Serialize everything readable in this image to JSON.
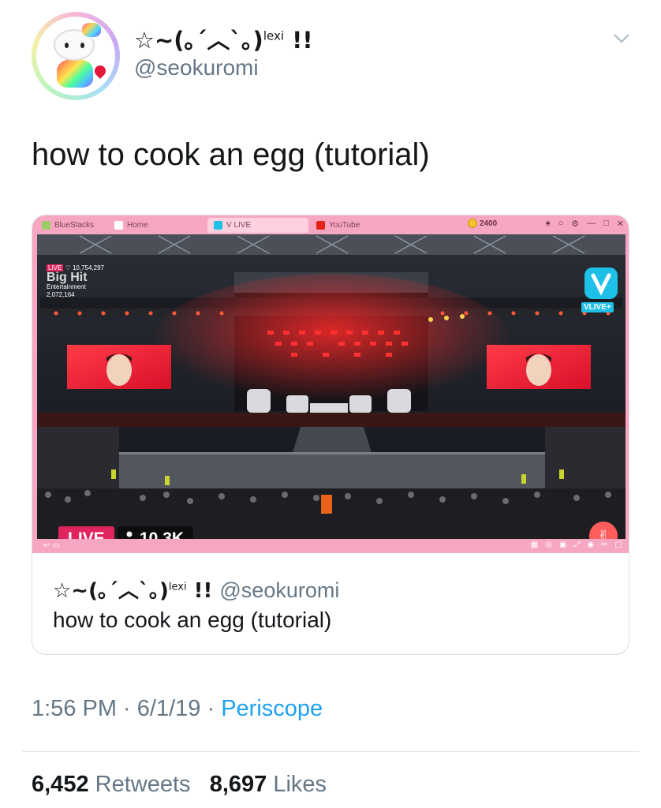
{
  "header": {
    "display_name": "☆~(｡´︿`｡)",
    "display_name_sup": "lexi",
    "display_name_suffix": " !!",
    "handle": "@seokuromi",
    "avatar_icon": "hello-kitty-avatar",
    "menu_icon": "chevron-down-icon"
  },
  "tweet": {
    "text": "how to cook an egg (tutorial)"
  },
  "embed": {
    "app_tabs": [
      "BlueStacks",
      "Home",
      "V LIVE",
      "YouTube"
    ],
    "coins": "2400",
    "window_controls": [
      "♠",
      "○",
      "⚙",
      "—",
      "□",
      "✕"
    ],
    "overlay": {
      "live_small": "LIVE",
      "hearts": "10,754,297",
      "brand": "Big Hit",
      "brand_sub": "Entertainment",
      "plays": "2,072,164"
    },
    "vlive_label": "VLIVE+",
    "live_badge": "LIVE",
    "viewers": "10.3K",
    "quote": {
      "display_name": "☆~(｡´︿`｡)",
      "display_name_sup": "lexi",
      "display_name_suffix": " !! ",
      "handle": "@seokuromi",
      "text": "how to cook an egg (tutorial)"
    }
  },
  "meta": {
    "time": "1:56 PM",
    "sep1": " · ",
    "date": "6/1/19",
    "sep2": " · ",
    "source": "Periscope"
  },
  "stats": {
    "retweets_count": "6,452",
    "retweets_label": "Retweets",
    "likes_count": "8,697",
    "likes_label": "Likes"
  },
  "colors": {
    "accent": "#1da1f2",
    "live_red": "#e0245e",
    "app_pink": "#f7a6c2"
  }
}
